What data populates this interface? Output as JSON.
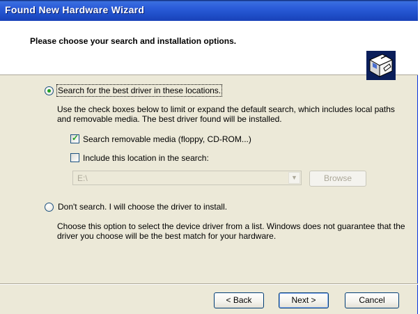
{
  "window": {
    "title": "Found New Hardware Wizard"
  },
  "header": {
    "title": "Please choose your search and installation options."
  },
  "options": {
    "search": {
      "label": "Search for the best driver in these locations.",
      "selected": true,
      "description": "Use the check boxes below to limit or expand the default search, which includes local paths and removable media. The best driver found will be installed.",
      "removable_media": {
        "label": "Search removable media (floppy, CD-ROM...)",
        "checked": true
      },
      "include_location": {
        "label": "Include this location in the search:",
        "checked": false
      },
      "location_value": "E:\\",
      "browse_label": "Browse"
    },
    "dont_search": {
      "label": "Don't search. I will choose the driver to install.",
      "selected": false,
      "description": "Choose this option to select the device driver from a list.  Windows does not guarantee that the driver you choose will be the best match for your hardware."
    }
  },
  "buttons": {
    "back": "< Back",
    "next": "Next >",
    "cancel": "Cancel"
  },
  "icons": {
    "wizard": "hardware-wizard-icon",
    "dropdown": "chevron-down-icon"
  },
  "colors": {
    "title_bar": "#2a5bd8",
    "dialog_bg": "#ece9d8",
    "radio_dot": "#21a121"
  }
}
